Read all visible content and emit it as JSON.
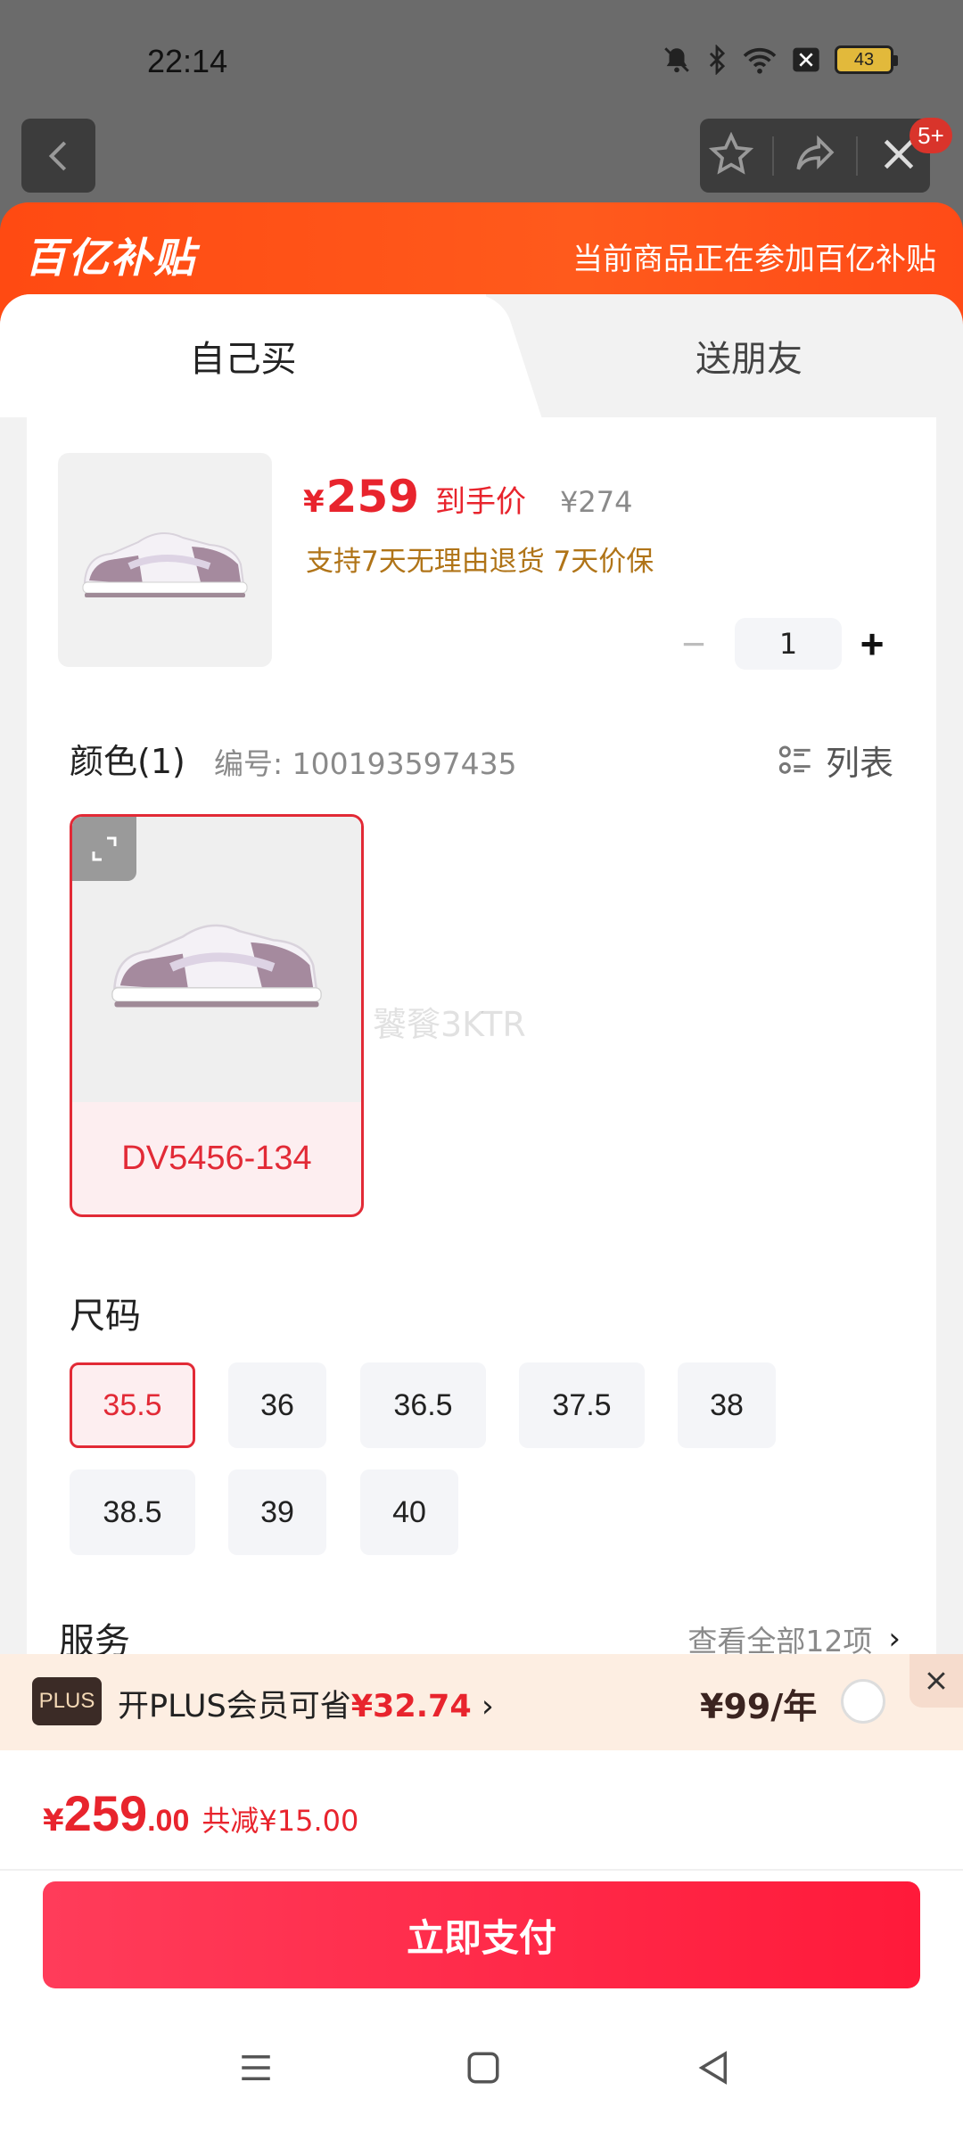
{
  "status_bar": {
    "time": "22:14",
    "battery": "43",
    "icons": [
      "mute-icon",
      "bluetooth-icon",
      "wifi-icon",
      "sim-icon",
      "battery-icon"
    ]
  },
  "nav": {
    "back_icon": "chevron-left-icon",
    "actions": [
      "star-icon",
      "share-icon",
      "close-icon"
    ],
    "badge": "5+"
  },
  "banner": {
    "logo": "百亿补贴",
    "note": "当前商品正在参加百亿补贴"
  },
  "tabs": [
    {
      "label": "自己买",
      "active": true
    },
    {
      "label": "送朋友",
      "active": false
    }
  ],
  "product": {
    "currency": "¥",
    "price": "259",
    "price_label": "到手价",
    "original_price": "¥274",
    "promise": "支持7天无理由退货  7天价保",
    "quantity": "1",
    "minus": "−",
    "plus": "+"
  },
  "color": {
    "title": "颜色(1)",
    "code": "编号: 100193597435",
    "list_label": "列表",
    "options": [
      {
        "name": "DV5456-134",
        "selected": true
      }
    ],
    "watermark": "饕餮3KTR"
  },
  "size": {
    "title": "尺码",
    "options": [
      {
        "label": "35.5",
        "selected": true
      },
      {
        "label": "36",
        "selected": false
      },
      {
        "label": "36.5",
        "selected": false
      },
      {
        "label": "37.5",
        "selected": false
      },
      {
        "label": "38",
        "selected": false
      },
      {
        "label": "38.5",
        "selected": false
      },
      {
        "label": "39",
        "selected": false
      },
      {
        "label": "40",
        "selected": false
      }
    ]
  },
  "service": {
    "title": "服务",
    "view_all": "查看全部12项",
    "chevron": "›"
  },
  "plus": {
    "badge": "PLUS",
    "text": "开PLUS会员可省",
    "saving": "¥32.74",
    "chevron": "›",
    "price": "¥99/年"
  },
  "summary": {
    "currency": "¥",
    "integer": "259",
    "decimal": ".00",
    "discount": "共减¥15.00"
  },
  "pay_button": "立即支付",
  "colors": {
    "accent_red": "#e8242d",
    "banner_orange": "#ff4a12",
    "pay_gradient_start": "#ff3c5a",
    "pay_gradient_end": "#ff1a3a"
  }
}
